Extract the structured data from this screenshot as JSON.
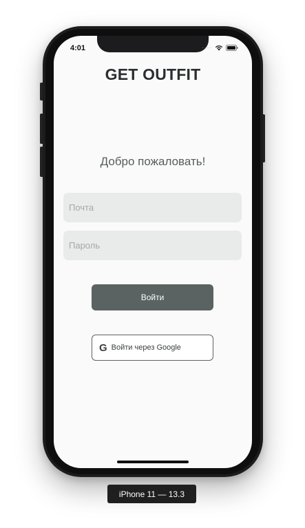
{
  "status_bar": {
    "time": "4:01",
    "signal": "····"
  },
  "app": {
    "title": "GET OUTFIT",
    "welcome_text": "Добро пожаловать!"
  },
  "form": {
    "email_placeholder": "Почта",
    "password_placeholder": "Пароль",
    "email_value": "",
    "password_value": ""
  },
  "buttons": {
    "login_label": "Войти",
    "google_label": "Войти через Google",
    "google_icon_glyph": "G"
  },
  "device": {
    "label": "iPhone 11 — 13.3"
  },
  "colors": {
    "primary_button": "#5a6361",
    "field_background": "#e9ebea",
    "screen_background": "#fafafa",
    "title_text": "#2b2f30"
  },
  "icons": [
    "wifi-icon",
    "battery-icon",
    "google-icon"
  ]
}
